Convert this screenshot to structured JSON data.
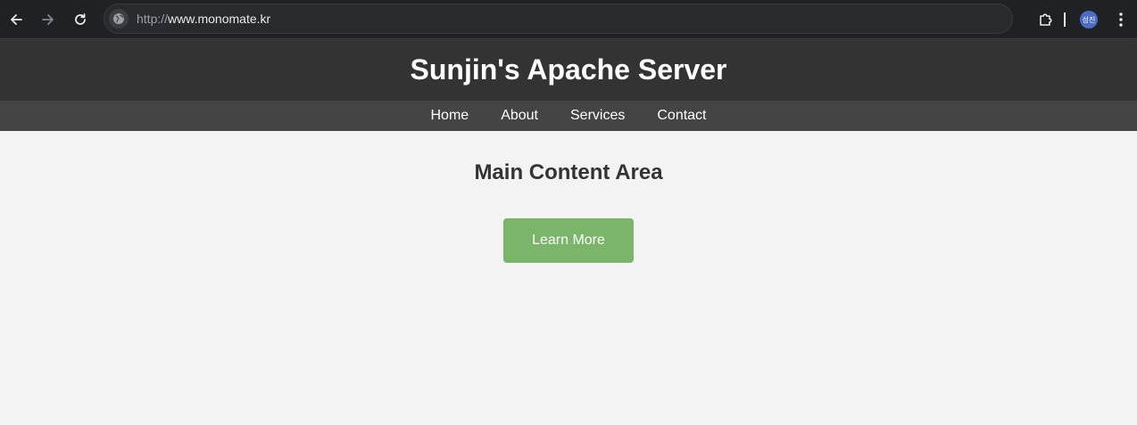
{
  "browser": {
    "url_scheme": "http://",
    "url_host": "www.monomate.kr",
    "profile_label": "성진"
  },
  "site": {
    "title": "Sunjin's Apache Server",
    "nav": [
      "Home",
      "About",
      "Services",
      "Contact"
    ]
  },
  "main": {
    "heading": "Main Content Area",
    "button_label": "Learn More"
  },
  "colors": {
    "header_bg": "#333333",
    "nav_bg": "#444444",
    "page_bg": "#f3f3f3",
    "button_bg": "#7ab56a"
  },
  "icons": [
    "back-arrow-icon",
    "forward-arrow-icon",
    "reload-icon",
    "globe-icon",
    "extensions-puzzle-icon",
    "profile-avatar",
    "more-vert-icon"
  ]
}
